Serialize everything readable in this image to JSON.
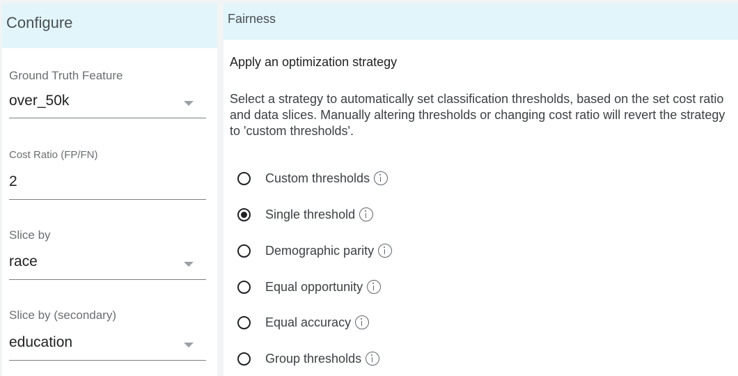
{
  "configure": {
    "title": "Configure",
    "ground_truth": {
      "label": "Ground Truth Feature",
      "value": "over_50k"
    },
    "cost_ratio": {
      "label": "Cost Ratio (FP/FN)",
      "value": "2"
    },
    "slice_by": {
      "label": "Slice by",
      "value": "race"
    },
    "slice_by_secondary": {
      "label": "Slice by (secondary)",
      "value": "education"
    }
  },
  "fairness": {
    "title": "Fairness",
    "heading": "Apply an optimization strategy",
    "description": "Select a strategy to automatically set classification thresholds, based on the set cost ratio and data slices. Manually altering thresholds or changing cost ratio will revert the strategy to 'custom thresholds'.",
    "strategies": [
      {
        "label": "Custom thresholds",
        "selected": false
      },
      {
        "label": "Single threshold",
        "selected": true
      },
      {
        "label": "Demographic parity",
        "selected": false
      },
      {
        "label": "Equal opportunity",
        "selected": false
      },
      {
        "label": "Equal accuracy",
        "selected": false
      },
      {
        "label": "Group thresholds",
        "selected": false
      }
    ]
  },
  "colors": {
    "header_background": "#e2f5fb",
    "page_background": "#f1f3f4",
    "radio_selected": "#202124"
  }
}
